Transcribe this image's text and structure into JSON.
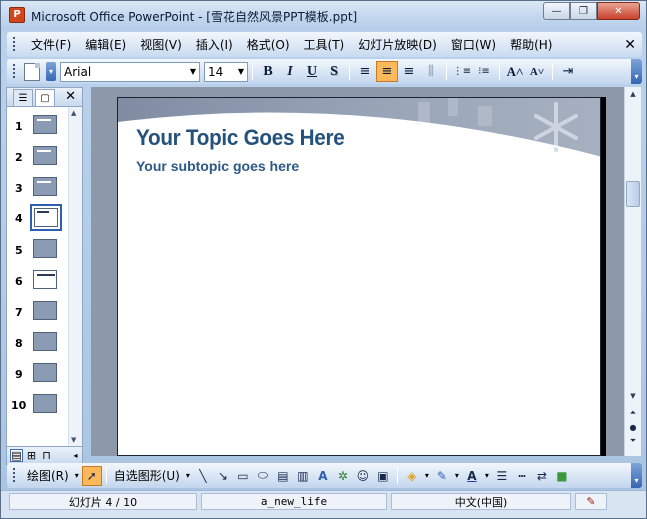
{
  "window": {
    "title": "Microsoft Office PowerPoint - [雪花自然风景PPT模板.ppt]",
    "app_icon_letter": "P",
    "minimize_glyph": "—",
    "restore_glyph": "❐",
    "close_glyph": "✕"
  },
  "menubar": {
    "items": [
      "文件(F)",
      "编辑(E)",
      "视图(V)",
      "插入(I)",
      "格式(O)",
      "工具(T)",
      "幻灯片放映(D)",
      "窗口(W)",
      "帮助(H)"
    ],
    "close_glyph": "✕"
  },
  "toolbar": {
    "font": "Arial",
    "font_size": "14",
    "bold": "B",
    "italic": "I",
    "underline": "U",
    "shadow": "S",
    "align_left": "≡",
    "align_center": "≡",
    "align_right": "≡",
    "distribute": "⫼",
    "numbered_list": "⋮≡",
    "bullet_list": "⁝≡",
    "increase_font": "A˄",
    "decrease_font": "A˅",
    "indent": "⇥"
  },
  "slide_panel": {
    "tabs": [
      "outline-tab",
      "slides-tab"
    ],
    "close_glyph": "✕",
    "slides": [
      {
        "number": "1",
        "style": "dark"
      },
      {
        "number": "2",
        "style": "dark"
      },
      {
        "number": "3",
        "style": "dark"
      },
      {
        "number": "4",
        "style": "white",
        "selected": true
      },
      {
        "number": "5",
        "style": "dark"
      },
      {
        "number": "6",
        "style": "white"
      },
      {
        "number": "7",
        "style": "dark"
      },
      {
        "number": "8",
        "style": "dark"
      },
      {
        "number": "9",
        "style": "dark"
      },
      {
        "number": "10",
        "style": "dark"
      }
    ],
    "views": [
      "normal-view",
      "slide-sorter-view",
      "slideshow-view"
    ]
  },
  "slide": {
    "title": "Your Topic Goes Here",
    "subtitle": "Your subtopic goes here",
    "colors": {
      "header": "#9aa6b8",
      "title": "#24527c"
    }
  },
  "drawing_toolbar": {
    "draw_label": "绘图(R)",
    "autoshapes_label": "自选图形(U)"
  },
  "statusbar": {
    "slide_indicator": "幻灯片 4 / 10",
    "design": "a_new_life",
    "language": "中文(中国)"
  }
}
